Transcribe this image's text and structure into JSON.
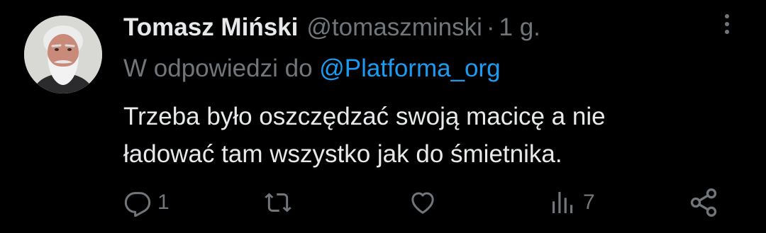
{
  "tweet": {
    "author": {
      "display_name": "Tomasz Miński",
      "handle": "@tomaszminski",
      "separator": "·",
      "time": "1 g."
    },
    "reply_to": {
      "prefix": "W odpowiedzi do",
      "target": "@Platforma_org"
    },
    "text_lines": [
      "Trzeba było oszczędzać swoją macicę a nie",
      "ładować tam wszystko jak do śmietnika."
    ],
    "actions": {
      "reply_count": "1",
      "views_count": "7"
    },
    "icons": {
      "more": "more-vertical-icon",
      "reply": "reply-icon",
      "retweet": "retweet-icon",
      "like": "heart-icon",
      "views": "views-icon",
      "share": "share-icon"
    },
    "colors": {
      "background": "#000000",
      "text_primary": "#e7e9ea",
      "text_secondary": "#71767b",
      "link": "#1d9bf0"
    }
  }
}
